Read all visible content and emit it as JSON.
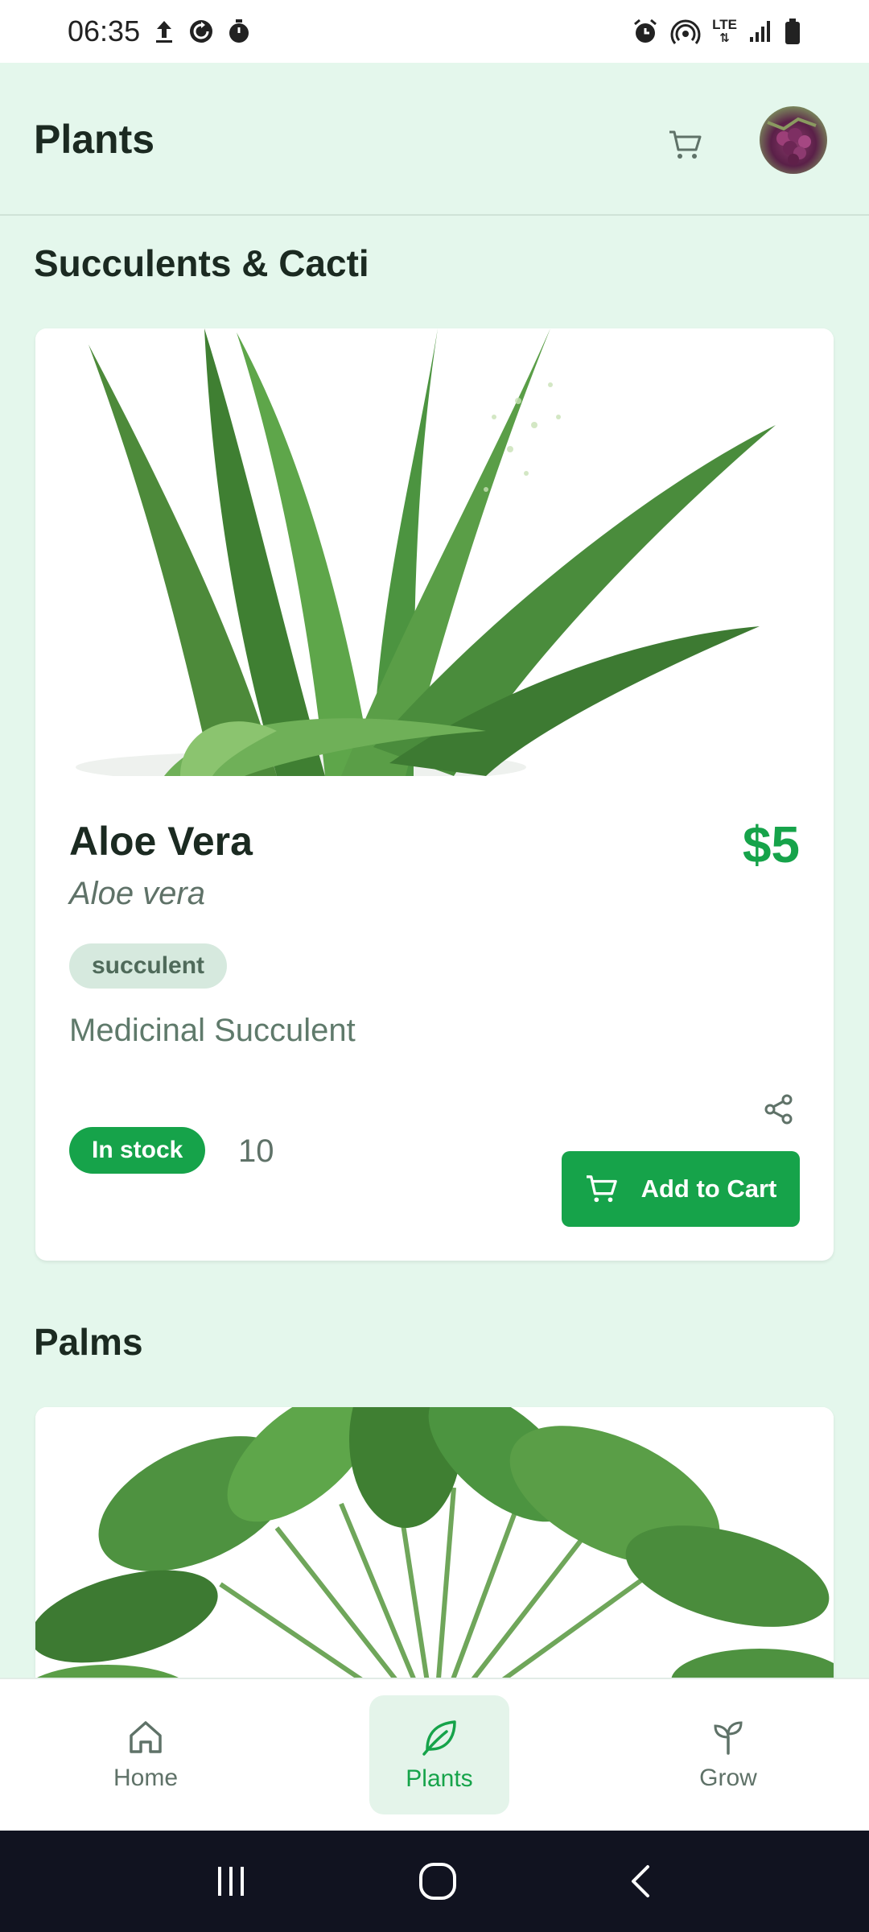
{
  "status_bar": {
    "time": "06:35",
    "left_icons": [
      "upload-icon",
      "sync-icon",
      "stopwatch-icon"
    ],
    "right_icons": [
      "alarm-icon",
      "hotspot-icon",
      "lte-icon",
      "signal-icon",
      "battery-icon"
    ],
    "network_label": "LTE"
  },
  "header": {
    "title": "Plants",
    "cart_icon": "cart-icon",
    "avatar_icon": "avatar"
  },
  "sections": [
    {
      "heading": "Succulents & Cacti",
      "card": {
        "name": "Aloe Vera",
        "scientific_name": "Aloe vera",
        "price": "$5",
        "tag": "succulent",
        "description": "Medicinal Succulent",
        "stock_status": "In stock",
        "stock_count": "10",
        "add_to_cart_label": "Add to Cart",
        "image": "aloe-vera-plant-image"
      }
    },
    {
      "heading": "Palms",
      "card": {
        "image": "palm-plant-image"
      }
    }
  ],
  "bottom_nav": {
    "items": [
      {
        "label": "Home",
        "icon": "home-icon",
        "active": false
      },
      {
        "label": "Plants",
        "icon": "leaf-icon",
        "active": true
      },
      {
        "label": "Grow",
        "icon": "sprout-icon",
        "active": false
      }
    ]
  },
  "system_nav": [
    "recents-icon",
    "home-circle-icon",
    "back-icon"
  ],
  "colors": {
    "accent": "#16a34a",
    "background": "#e4f7ec",
    "card": "#ffffff"
  }
}
